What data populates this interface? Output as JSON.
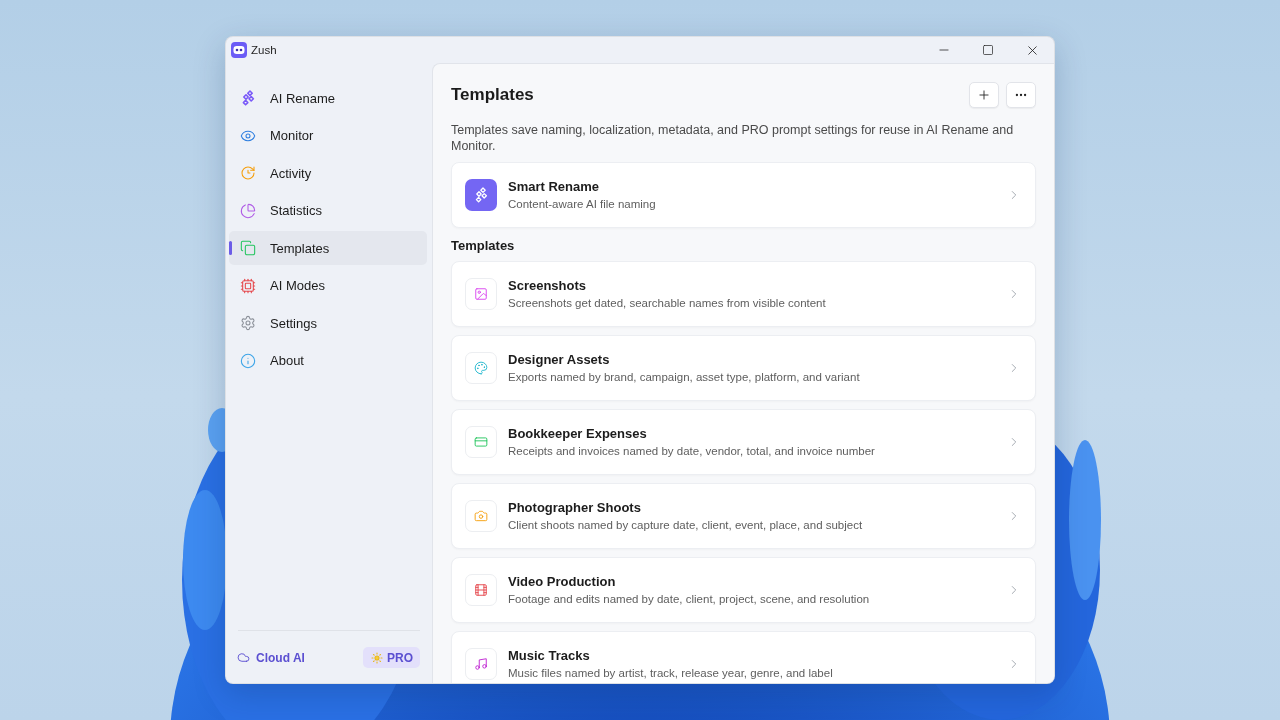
{
  "window": {
    "title": "Zush"
  },
  "sidebar": {
    "items": [
      {
        "label": "AI Rename",
        "selected": false
      },
      {
        "label": "Monitor",
        "selected": false
      },
      {
        "label": "Activity",
        "selected": false
      },
      {
        "label": "Statistics",
        "selected": false
      },
      {
        "label": "Templates",
        "selected": true
      },
      {
        "label": "AI Modes",
        "selected": false
      },
      {
        "label": "Settings",
        "selected": false
      },
      {
        "label": "About",
        "selected": false
      }
    ],
    "footer": {
      "cloud_link": "Cloud AI",
      "badge": "PRO"
    }
  },
  "page": {
    "title": "Templates",
    "description": "Templates save naming, localization, metadata, and PRO prompt settings for reuse in AI Rename and Monitor.",
    "featured": {
      "title": "Smart Rename",
      "subtitle": "Content-aware AI file naming"
    },
    "section_title": "Templates",
    "templates": [
      {
        "title": "Screenshots",
        "subtitle": "Screenshots get dated, searchable names from visible content"
      },
      {
        "title": "Designer Assets",
        "subtitle": "Exports named by brand, campaign, asset type, platform, and variant"
      },
      {
        "title": "Bookkeeper Expenses",
        "subtitle": "Receipts and invoices named by date, vendor, total, and invoice number"
      },
      {
        "title": "Photographer Shoots",
        "subtitle": "Client shoots named by capture date, client, event, place, and subject"
      },
      {
        "title": "Video Production",
        "subtitle": "Footage and edits named by date, client, project, scene, and resolution"
      },
      {
        "title": "Music Tracks",
        "subtitle": "Music files named by artist, track, release year, genre, and label"
      }
    ]
  }
}
